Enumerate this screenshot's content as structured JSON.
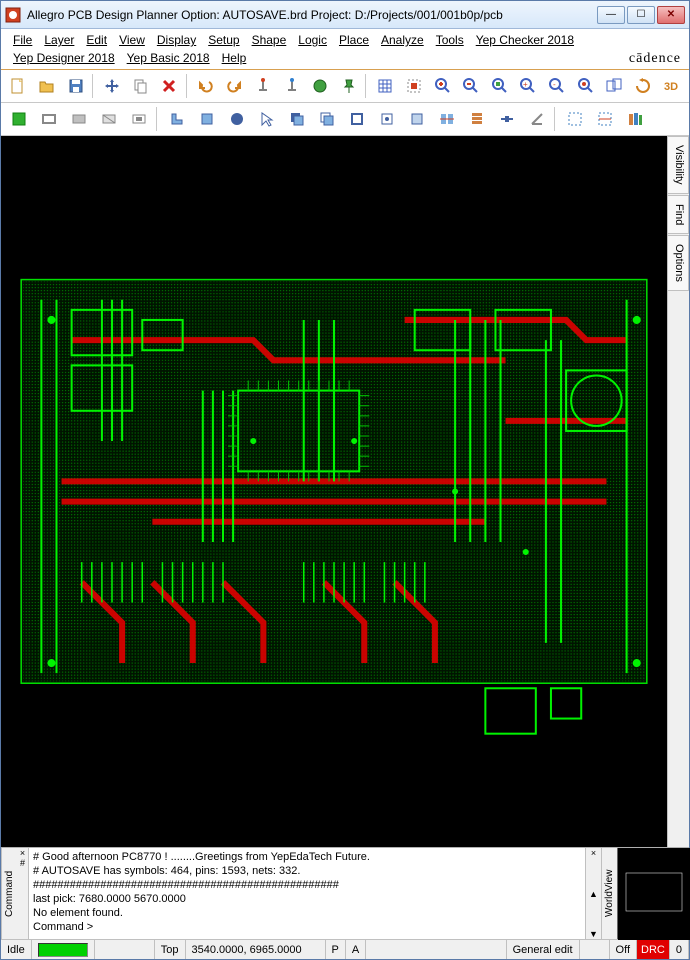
{
  "window": {
    "title": "Allegro PCB Design Planner Option: AUTOSAVE.brd  Project: D:/Projects/001/001b0p/pcb"
  },
  "menu": {
    "row1": [
      "File",
      "Layer",
      "Edit",
      "View",
      "Display",
      "Setup",
      "Shape",
      "Logic",
      "Place",
      "Analyze",
      "Tools",
      "Yep Checker 2018"
    ],
    "row2": [
      "Yep Designer 2018",
      "Yep Basic 2018",
      "Help"
    ],
    "brand": "cādence"
  },
  "sidetabs": [
    "Visibility",
    "Find",
    "Options"
  ],
  "command": {
    "tab": "Command",
    "lines": [
      "#  Good afternoon PC8770 !   ........Greetings from YepEdaTech Future.",
      "#  AUTOSAVE has symbols: 464, pins: 1593, nets: 332.",
      "##################################################",
      "last pick:  7680.0000 5670.0000",
      "No element found.",
      "Command >"
    ]
  },
  "minimap_tab": "WorldView",
  "status": {
    "state": "Idle",
    "layer": "Top",
    "coords": "3540.0000, 6965.0000",
    "p": "P",
    "a": "A",
    "mode": "General edit",
    "off": "Off",
    "drc": "DRC",
    "count": "0"
  },
  "icons": {
    "new": "new",
    "open": "open",
    "save": "save",
    "move": "move",
    "copy": "copy",
    "delete": "delete",
    "undo": "undo",
    "redo": "redo",
    "down1": "down",
    "down2": "down",
    "circle": "circle",
    "pin": "pin",
    "grid": "grid",
    "area": "area",
    "zoomin": "zoomin",
    "zoomout": "zoomout",
    "zoomfit": "zoomfit",
    "zoomin2": "zoomin2",
    "zoomout2": "zoomout2",
    "zoomsel": "zoomsel",
    "zoomprev": "zoomprev",
    "refresh": "refresh",
    "threed": "3D",
    "square": "square",
    "rect1": "rect",
    "rect2": "rect",
    "line": "line",
    "circ": "circ",
    "arrow": "arrow",
    "layer1": "layer",
    "layer2": "layer",
    "box1": "box",
    "box2": "box",
    "box3": "box",
    "align": "align",
    "stack": "stack",
    "ruler": "ruler",
    "ang": "angle",
    "dotted": "dotted",
    "nets": "nets",
    "books": "books"
  }
}
